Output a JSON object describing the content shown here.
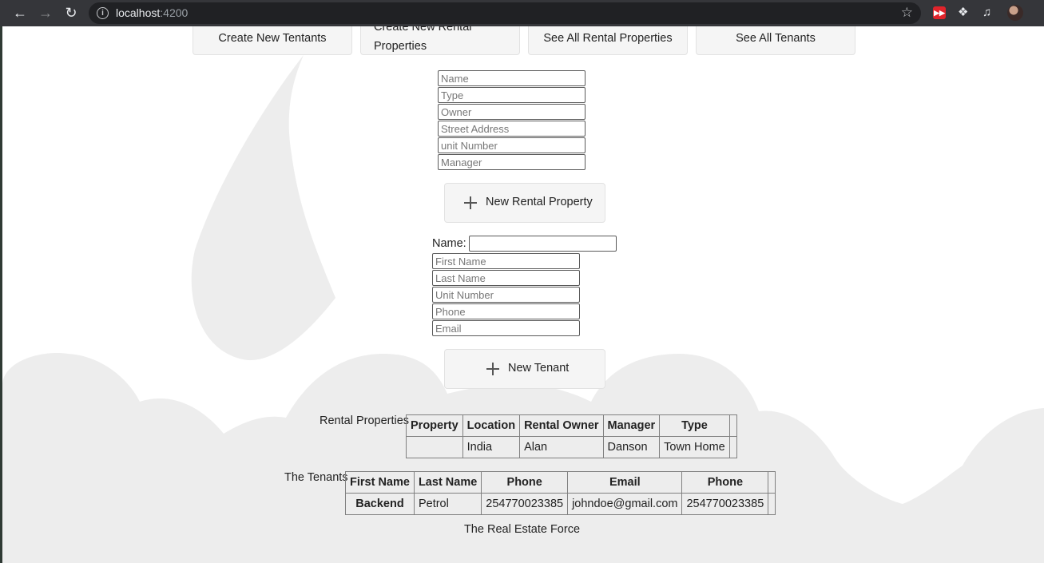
{
  "browser": {
    "url_host": "localhost",
    "url_port": ":4200",
    "icons": [
      "back-arrow-icon",
      "forward-arrow-icon",
      "reload-icon",
      "info-icon",
      "star-icon",
      "extension-red-icon",
      "puzzle-icon",
      "media-icon",
      "profile-avatar"
    ]
  },
  "nav": {
    "create_tenants": "Create New Tentants",
    "create_rental": "Create New Rental Properties",
    "see_rentals": "See All Rental Properties",
    "see_tenants": "See All Tenants"
  },
  "property_form": {
    "name": "Name",
    "type": "Type",
    "owner": "Owner",
    "street": "Street Address",
    "unit": "unit Number",
    "manager": "Manager",
    "button": "New Rental Property"
  },
  "tenant_form": {
    "name_label": "Name:",
    "name_value": "",
    "first": "First Name",
    "last": "Last Name",
    "unit": "Unit Number",
    "phone": "Phone",
    "email": "Email",
    "button": "New Tenant"
  },
  "rental_table": {
    "caption": "Rental Properties",
    "headers": [
      "Property",
      "Location",
      "Rental Owner",
      "Manager",
      "Type",
      ""
    ],
    "rows": [
      [
        "",
        "India",
        "Alan",
        "Danson",
        "Town Home",
        ""
      ]
    ]
  },
  "tenant_table": {
    "caption": "The Tenants",
    "headers": [
      "First Name",
      "Last Name",
      "Phone",
      "Email",
      "Phone",
      ""
    ],
    "rows": [
      [
        "Backend",
        "Petrol",
        "254770023385",
        "johndoe@gmail.com",
        "254770023385",
        ""
      ]
    ]
  },
  "footer": "The Real Estate Force",
  "colors": {
    "cloud": "#ededed",
    "chrome": "#35363a",
    "omnibox": "#202124"
  }
}
